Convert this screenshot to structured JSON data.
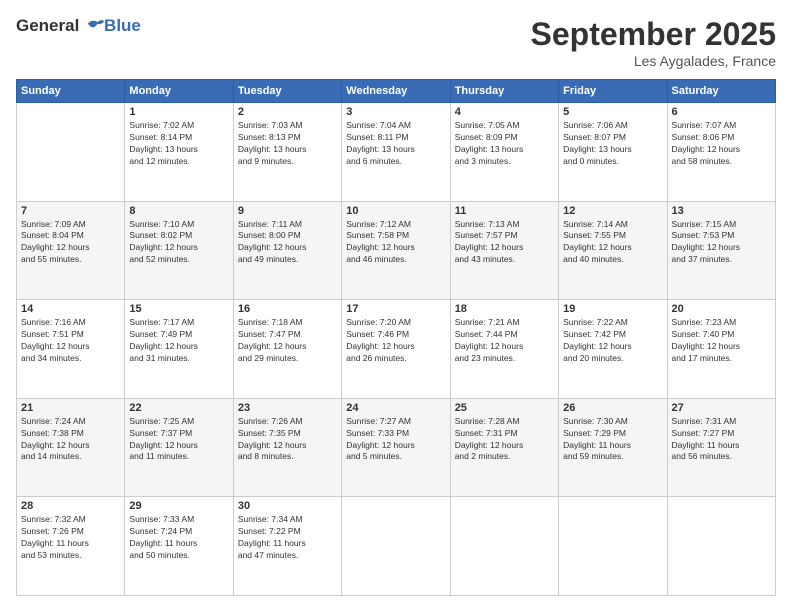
{
  "logo": {
    "line1": "General",
    "line2": "Blue"
  },
  "header": {
    "month": "September 2025",
    "location": "Les Aygalades, France"
  },
  "weekdays": [
    "Sunday",
    "Monday",
    "Tuesday",
    "Wednesday",
    "Thursday",
    "Friday",
    "Saturday"
  ],
  "weeks": [
    [
      {
        "day": "",
        "info": ""
      },
      {
        "day": "1",
        "info": "Sunrise: 7:02 AM\nSunset: 8:14 PM\nDaylight: 13 hours\nand 12 minutes."
      },
      {
        "day": "2",
        "info": "Sunrise: 7:03 AM\nSunset: 8:13 PM\nDaylight: 13 hours\nand 9 minutes."
      },
      {
        "day": "3",
        "info": "Sunrise: 7:04 AM\nSunset: 8:11 PM\nDaylight: 13 hours\nand 6 minutes."
      },
      {
        "day": "4",
        "info": "Sunrise: 7:05 AM\nSunset: 8:09 PM\nDaylight: 13 hours\nand 3 minutes."
      },
      {
        "day": "5",
        "info": "Sunrise: 7:06 AM\nSunset: 8:07 PM\nDaylight: 13 hours\nand 0 minutes."
      },
      {
        "day": "6",
        "info": "Sunrise: 7:07 AM\nSunset: 8:06 PM\nDaylight: 12 hours\nand 58 minutes."
      }
    ],
    [
      {
        "day": "7",
        "info": "Sunrise: 7:09 AM\nSunset: 8:04 PM\nDaylight: 12 hours\nand 55 minutes."
      },
      {
        "day": "8",
        "info": "Sunrise: 7:10 AM\nSunset: 8:02 PM\nDaylight: 12 hours\nand 52 minutes."
      },
      {
        "day": "9",
        "info": "Sunrise: 7:11 AM\nSunset: 8:00 PM\nDaylight: 12 hours\nand 49 minutes."
      },
      {
        "day": "10",
        "info": "Sunrise: 7:12 AM\nSunset: 7:58 PM\nDaylight: 12 hours\nand 46 minutes."
      },
      {
        "day": "11",
        "info": "Sunrise: 7:13 AM\nSunset: 7:57 PM\nDaylight: 12 hours\nand 43 minutes."
      },
      {
        "day": "12",
        "info": "Sunrise: 7:14 AM\nSunset: 7:55 PM\nDaylight: 12 hours\nand 40 minutes."
      },
      {
        "day": "13",
        "info": "Sunrise: 7:15 AM\nSunset: 7:53 PM\nDaylight: 12 hours\nand 37 minutes."
      }
    ],
    [
      {
        "day": "14",
        "info": "Sunrise: 7:16 AM\nSunset: 7:51 PM\nDaylight: 12 hours\nand 34 minutes."
      },
      {
        "day": "15",
        "info": "Sunrise: 7:17 AM\nSunset: 7:49 PM\nDaylight: 12 hours\nand 31 minutes."
      },
      {
        "day": "16",
        "info": "Sunrise: 7:18 AM\nSunset: 7:47 PM\nDaylight: 12 hours\nand 29 minutes."
      },
      {
        "day": "17",
        "info": "Sunrise: 7:20 AM\nSunset: 7:46 PM\nDaylight: 12 hours\nand 26 minutes."
      },
      {
        "day": "18",
        "info": "Sunrise: 7:21 AM\nSunset: 7:44 PM\nDaylight: 12 hours\nand 23 minutes."
      },
      {
        "day": "19",
        "info": "Sunrise: 7:22 AM\nSunset: 7:42 PM\nDaylight: 12 hours\nand 20 minutes."
      },
      {
        "day": "20",
        "info": "Sunrise: 7:23 AM\nSunset: 7:40 PM\nDaylight: 12 hours\nand 17 minutes."
      }
    ],
    [
      {
        "day": "21",
        "info": "Sunrise: 7:24 AM\nSunset: 7:38 PM\nDaylight: 12 hours\nand 14 minutes."
      },
      {
        "day": "22",
        "info": "Sunrise: 7:25 AM\nSunset: 7:37 PM\nDaylight: 12 hours\nand 11 minutes."
      },
      {
        "day": "23",
        "info": "Sunrise: 7:26 AM\nSunset: 7:35 PM\nDaylight: 12 hours\nand 8 minutes."
      },
      {
        "day": "24",
        "info": "Sunrise: 7:27 AM\nSunset: 7:33 PM\nDaylight: 12 hours\nand 5 minutes."
      },
      {
        "day": "25",
        "info": "Sunrise: 7:28 AM\nSunset: 7:31 PM\nDaylight: 12 hours\nand 2 minutes."
      },
      {
        "day": "26",
        "info": "Sunrise: 7:30 AM\nSunset: 7:29 PM\nDaylight: 11 hours\nand 59 minutes."
      },
      {
        "day": "27",
        "info": "Sunrise: 7:31 AM\nSunset: 7:27 PM\nDaylight: 11 hours\nand 56 minutes."
      }
    ],
    [
      {
        "day": "28",
        "info": "Sunrise: 7:32 AM\nSunset: 7:26 PM\nDaylight: 11 hours\nand 53 minutes."
      },
      {
        "day": "29",
        "info": "Sunrise: 7:33 AM\nSunset: 7:24 PM\nDaylight: 11 hours\nand 50 minutes."
      },
      {
        "day": "30",
        "info": "Sunrise: 7:34 AM\nSunset: 7:22 PM\nDaylight: 11 hours\nand 47 minutes."
      },
      {
        "day": "",
        "info": ""
      },
      {
        "day": "",
        "info": ""
      },
      {
        "day": "",
        "info": ""
      },
      {
        "day": "",
        "info": ""
      }
    ]
  ]
}
